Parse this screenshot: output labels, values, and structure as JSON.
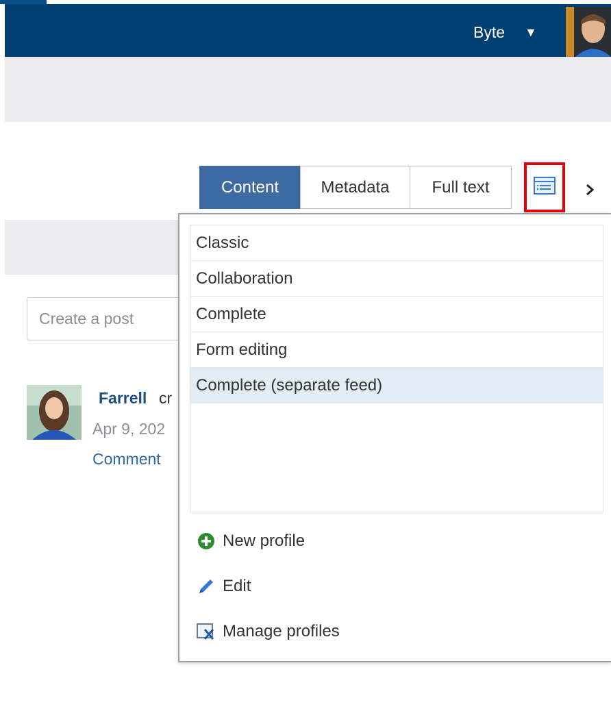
{
  "header": {
    "user_name": "Byte",
    "caret": "▼"
  },
  "tabs": [
    {
      "label": "Content",
      "active": true
    },
    {
      "label": "Metadata",
      "active": false
    },
    {
      "label": "Full text",
      "active": false
    }
  ],
  "next_arrow": "›",
  "feed": {
    "post_placeholder": "Create a post",
    "author": "Farrell",
    "action_fragment": "cr",
    "date_fragment": "Apr 9, 202",
    "comment_link": "Comment"
  },
  "profile_menu": {
    "items": [
      {
        "label": "Classic",
        "selected": false
      },
      {
        "label": "Collaboration",
        "selected": false
      },
      {
        "label": "Complete",
        "selected": false
      },
      {
        "label": "Form editing",
        "selected": false
      },
      {
        "label": "Complete (separate feed)",
        "selected": true
      }
    ],
    "actions": [
      {
        "label": "New profile",
        "icon": "plus-circle-icon"
      },
      {
        "label": "Edit",
        "icon": "pencil-icon"
      },
      {
        "label": "Manage profiles",
        "icon": "manage-profiles-icon"
      }
    ]
  },
  "colors": {
    "header_bg": "#003f72",
    "tab_active_bg": "#3d6ba1",
    "highlight_border": "#e3000f",
    "selected_row_bg": "#e1ecf4",
    "link_color": "#2f6aa3"
  }
}
